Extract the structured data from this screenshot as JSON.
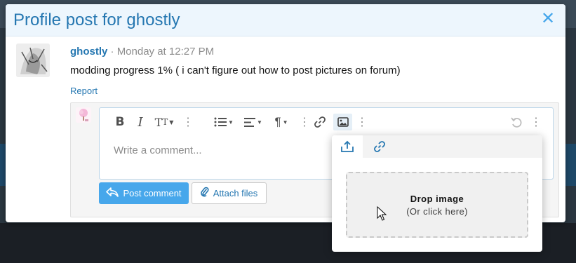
{
  "modal": {
    "title": "Profile post for ghostly",
    "close_icon": "close-icon"
  },
  "post": {
    "author": "ghostly",
    "separator": "·",
    "timestamp": "Monday at 12:27 PM",
    "message": "modding progress 1% ( i can't figure out how to post pictures on forum)",
    "report_label": "Report"
  },
  "editor": {
    "placeholder": "Write a comment...",
    "toolbar_icons": [
      "bold-icon",
      "italic-icon",
      "text-size-icon",
      "more-options-icon",
      "list-icon",
      "align-icon",
      "paragraph-icon",
      "more-options-icon",
      "link-icon",
      "image-icon",
      "more-options-icon",
      "undo-icon",
      "more-options-icon"
    ]
  },
  "actions": {
    "post_comment_label": "Post comment",
    "attach_files_label": "Attach files"
  },
  "image_popup": {
    "tabs": [
      "upload-icon",
      "link-icon"
    ],
    "drop_title": "Drop image",
    "drop_subtitle": "(Or click here)"
  },
  "colors": {
    "accent": "#47a7eb",
    "link": "#2577b1",
    "header_bg": "#edf6fd"
  }
}
